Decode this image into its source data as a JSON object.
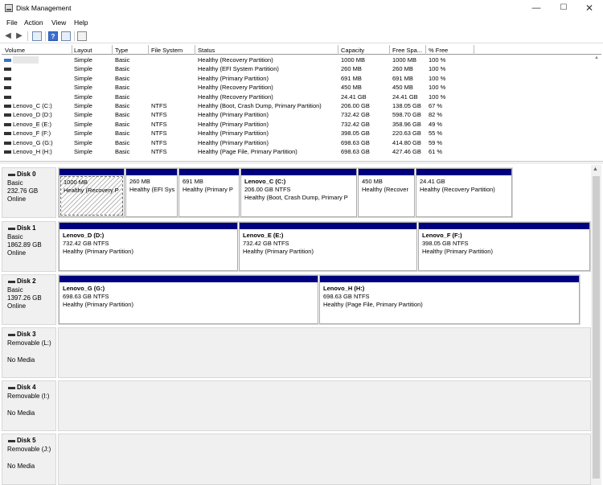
{
  "window": {
    "title": "Disk Management"
  },
  "menu": {
    "file": "File",
    "action": "Action",
    "view": "View",
    "help": "Help"
  },
  "toolbar": {
    "help_glyph": "?"
  },
  "volume_columns": [
    "Volume",
    "Layout",
    "Type",
    "File System",
    "Status",
    "Capacity",
    "Free Spa...",
    "% Free"
  ],
  "volumes": [
    {
      "volume": "",
      "layout": "Simple",
      "type": "Basic",
      "fs": "",
      "status": "Healthy (Recovery Partition)",
      "capacity": "1000 MB",
      "free": "1000 MB",
      "pct": "100 %"
    },
    {
      "volume": "",
      "layout": "Simple",
      "type": "Basic",
      "fs": "",
      "status": "Healthy (EFI System Partition)",
      "capacity": "260 MB",
      "free": "260 MB",
      "pct": "100 %"
    },
    {
      "volume": "",
      "layout": "Simple",
      "type": "Basic",
      "fs": "",
      "status": "Healthy (Primary Partition)",
      "capacity": "691 MB",
      "free": "691 MB",
      "pct": "100 %"
    },
    {
      "volume": "",
      "layout": "Simple",
      "type": "Basic",
      "fs": "",
      "status": "Healthy (Recovery Partition)",
      "capacity": "450 MB",
      "free": "450 MB",
      "pct": "100 %"
    },
    {
      "volume": "",
      "layout": "Simple",
      "type": "Basic",
      "fs": "",
      "status": "Healthy (Recovery Partition)",
      "capacity": "24.41 GB",
      "free": "24.41 GB",
      "pct": "100 %"
    },
    {
      "volume": "Lenovo_C (C:)",
      "layout": "Simple",
      "type": "Basic",
      "fs": "NTFS",
      "status": "Healthy (Boot, Crash Dump, Primary Partition)",
      "capacity": "206.00 GB",
      "free": "138.05 GB",
      "pct": "67 %"
    },
    {
      "volume": "Lenovo_D (D:)",
      "layout": "Simple",
      "type": "Basic",
      "fs": "NTFS",
      "status": "Healthy (Primary Partition)",
      "capacity": "732.42 GB",
      "free": "598.70 GB",
      "pct": "82 %"
    },
    {
      "volume": "Lenovo_E (E:)",
      "layout": "Simple",
      "type": "Basic",
      "fs": "NTFS",
      "status": "Healthy (Primary Partition)",
      "capacity": "732.42 GB",
      "free": "358.96 GB",
      "pct": "49 %"
    },
    {
      "volume": "Lenovo_F (F:)",
      "layout": "Simple",
      "type": "Basic",
      "fs": "NTFS",
      "status": "Healthy (Primary Partition)",
      "capacity": "398.05 GB",
      "free": "220.63 GB",
      "pct": "55 %"
    },
    {
      "volume": "Lenovo_G (G:)",
      "layout": "Simple",
      "type": "Basic",
      "fs": "NTFS",
      "status": "Healthy (Primary Partition)",
      "capacity": "698.63 GB",
      "free": "414.80 GB",
      "pct": "59 %"
    },
    {
      "volume": "Lenovo_H (H:)",
      "layout": "Simple",
      "type": "Basic",
      "fs": "NTFS",
      "status": "Healthy (Page File, Primary Partition)",
      "capacity": "698.63 GB",
      "free": "427.46 GB",
      "pct": "61 %"
    }
  ],
  "disks": [
    {
      "name": "Disk 0",
      "type": "Basic",
      "size": "232.76 GB",
      "status": "Online",
      "partitions": [
        {
          "title": "",
          "size": "1000 MB",
          "state": "Healthy (Recovery P"
        },
        {
          "title": "",
          "size": "260 MB",
          "state": "Healthy (EFI Sys"
        },
        {
          "title": "",
          "size": "691 MB",
          "state": "Healthy (Primary P"
        },
        {
          "title": "Lenovo_C  (C:)",
          "size": "206.00 GB NTFS",
          "state": "Healthy (Boot, Crash Dump, Primary P"
        },
        {
          "title": "",
          "size": "450 MB",
          "state": "Healthy (Recover"
        },
        {
          "title": "",
          "size": "24.41 GB",
          "state": "Healthy (Recovery Partition)"
        }
      ]
    },
    {
      "name": "Disk 1",
      "type": "Basic",
      "size": "1862.89 GB",
      "status": "Online",
      "partitions": [
        {
          "title": "Lenovo_D  (D:)",
          "size": "732.42 GB NTFS",
          "state": "Healthy (Primary Partition)"
        },
        {
          "title": "Lenovo_E  (E:)",
          "size": "732.42 GB NTFS",
          "state": "Healthy (Primary Partition)"
        },
        {
          "title": "Lenovo_F  (F:)",
          "size": "398.05 GB NTFS",
          "state": "Healthy (Primary Partition)"
        }
      ]
    },
    {
      "name": "Disk 2",
      "type": "Basic",
      "size": "1397.26 GB",
      "status": "Online",
      "partitions": [
        {
          "title": "Lenovo_G  (G:)",
          "size": "698.63 GB NTFS",
          "state": "Healthy (Primary Partition)"
        },
        {
          "title": "Lenovo_H  (H:)",
          "size": "698.63 GB NTFS",
          "state": "Healthy (Page File, Primary Partition)"
        }
      ]
    },
    {
      "name": "Disk 3",
      "type": "Removable (L:)",
      "media": "No Media"
    },
    {
      "name": "Disk 4",
      "type": "Removable (I:)",
      "media": "No Media"
    },
    {
      "name": "Disk 5",
      "type": "Removable (J:)",
      "media": "No Media"
    }
  ],
  "colors": {
    "partition_bar": "#00007f",
    "selected_volume_icon": "#3a73c8"
  }
}
